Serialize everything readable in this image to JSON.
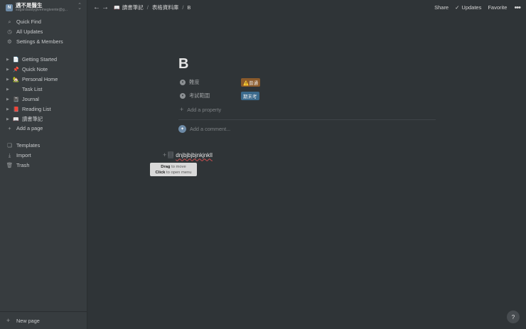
{
  "workspace": {
    "name": "邁不是醫生",
    "email": "sugardaddygivemegivente@g..."
  },
  "sidebar": {
    "nav": [
      {
        "label": "Quick Find",
        "icon": "search-icon"
      },
      {
        "label": "All Updates",
        "icon": "clock-icon"
      },
      {
        "label": "Settings & Members",
        "icon": "gear-icon"
      }
    ],
    "pages": [
      {
        "label": "Getting Started",
        "emoji": "📄"
      },
      {
        "label": "Quick Note",
        "emoji": "📌"
      },
      {
        "label": "Personal Home",
        "emoji": "🏡"
      },
      {
        "label": "Task List",
        "emoji": ""
      },
      {
        "label": "Journal",
        "emoji": "📓"
      },
      {
        "label": "Reading List",
        "emoji": "📕"
      },
      {
        "label": "讀書筆記",
        "emoji": "📖"
      }
    ],
    "add_page": "Add a page",
    "bottom": [
      {
        "label": "Templates",
        "icon": "templates-icon"
      },
      {
        "label": "Import",
        "icon": "import-icon"
      },
      {
        "label": "Trash",
        "icon": "trash-icon"
      }
    ],
    "new_page": "New page"
  },
  "topbar": {
    "breadcrumb": [
      "讀書筆記",
      "表格資料庫",
      "B"
    ],
    "share": "Share",
    "updates": "Updates",
    "favorite": "Favorite"
  },
  "page": {
    "title": "B",
    "properties": [
      {
        "name": "難度",
        "value": "⚠️普通",
        "color": "#8a5a2b"
      },
      {
        "name": "考試範圍",
        "value": "期末考",
        "color": "#3b6a8c"
      }
    ],
    "add_property": "Add a property",
    "add_comment": "Add a comment...",
    "block_text": "dnjbjbjbjnkjnkll"
  },
  "tooltip": {
    "drag_bold": "Drag",
    "drag_rest": " to move",
    "click_bold": "Click",
    "click_rest": " to open menu"
  }
}
